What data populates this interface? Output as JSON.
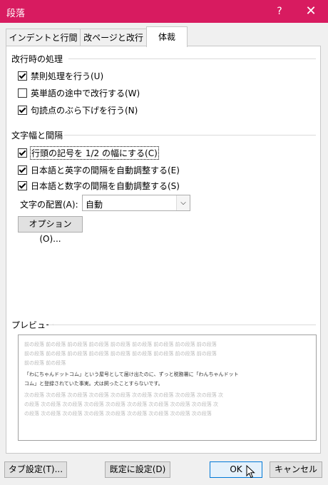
{
  "window": {
    "title": "段落",
    "help": "?",
    "close": "✕"
  },
  "tabs": [
    {
      "label": "インデントと行間隔",
      "active": false
    },
    {
      "label": "改ページと改行",
      "active": false
    },
    {
      "label": "体裁",
      "active": true
    }
  ],
  "line_break": {
    "heading": "改行時の処理",
    "options": [
      {
        "label": "禁則処理を行う(U)",
        "checked": true
      },
      {
        "label": "英単語の途中で改行する(W)",
        "checked": false
      },
      {
        "label": "句読点のぶら下げを行う(N)",
        "checked": true
      }
    ]
  },
  "char_width": {
    "heading": "文字幅と間隔",
    "options": [
      {
        "label": "行頭の記号を 1/2 の幅にする(C)",
        "checked": true
      },
      {
        "label": "日本語と英字の間隔を自動調整する(E)",
        "checked": true
      },
      {
        "label": "日本語と数字の間隔を自動調整する(S)",
        "checked": true
      }
    ],
    "alignment_label": "文字の配置(A):",
    "alignment_value": "自動",
    "options_button": "オプション(O)..."
  },
  "preview": {
    "heading": "プレビュー",
    "before_lines": [
      "前の段落 前の段落 前の段落 前の段落 前の段落 前の段落 前の段落 前の段落 前の段落",
      "前の段落 前の段落 前の段落 前の段落 前の段落 前の段落 前の段落 前の段落 前の段落",
      "前の段落 前の段落"
    ],
    "sample_lines": [
      "「わにちゃんドットコム」という屋号として届け出たのに、ずっと税務署に「わんちゃんドット",
      "コム」と登録されていた事実。犬は飼ったことすらないです。"
    ],
    "after_lines": [
      "次の段落 次の段落 次の段落 次の段落 次の段落 次の段落 次の段落 次の段落 次の段落 次",
      "の段落 次の段落 次の段落 次の段落 次の段落 次の段落 次の段落 次の段落 次の段落 次",
      "の段落 次の段落 次の段落 次の段落 次の段落 次の段落 次の段落 次の段落 次の段落"
    ]
  },
  "footer": {
    "tabs_button": "タブ設定(T)...",
    "default_button": "既定に設定(D)",
    "ok_button": "OK",
    "cancel_button": "キャンセル"
  }
}
